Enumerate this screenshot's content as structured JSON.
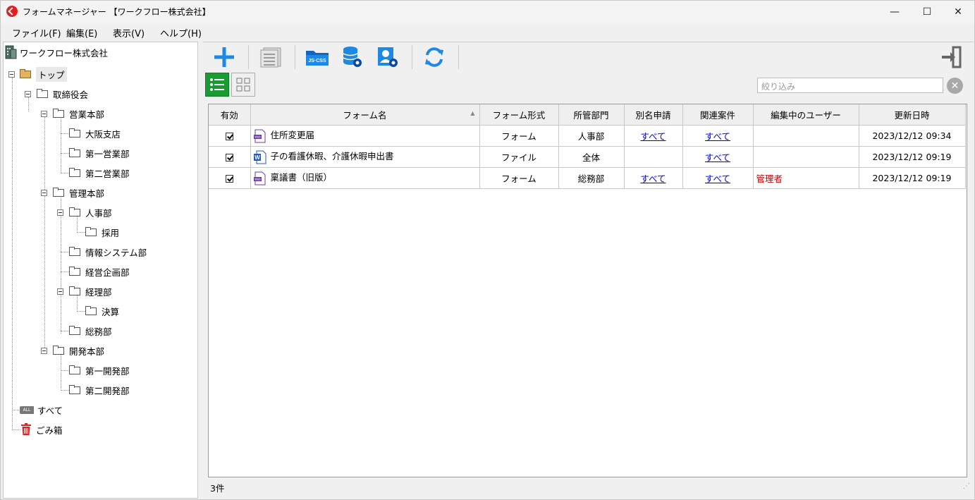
{
  "window": {
    "title": "フォームマネージャー 【ワークフロー株式会社】",
    "minimize": "—",
    "maximize": "☐",
    "close": "✕"
  },
  "menu": [
    "ファイル(F)",
    "編集(E)",
    "表示(V)",
    "ヘルプ(H)"
  ],
  "tree": {
    "root": "ワークフロー株式会社",
    "top": "トップ",
    "nodes": [
      "取締役会",
      "営業本部",
      "大阪支店",
      "第一営業部",
      "第二営業部",
      "管理本部",
      "人事部",
      "採用",
      "情報システム部",
      "経営企画部",
      "経理部",
      "決算",
      "総務部",
      "開発本部",
      "第一開発部",
      "第二開発部"
    ],
    "all": "すべて",
    "all_badge": "ALL",
    "trash": "ごみ箱"
  },
  "filter": {
    "placeholder": "絞り込み"
  },
  "table": {
    "columns": [
      "有効",
      "フォーム名",
      "フォーム形式",
      "所管部門",
      "別名申請",
      "関連案件",
      "編集中のユーザー",
      "更新日時"
    ],
    "rows": [
      {
        "enabled": true,
        "icon": "web-form-icon",
        "name": "住所変更届",
        "type": "フォーム",
        "dept": "人事部",
        "alias": "すべて",
        "related": "すべて",
        "editor": "",
        "updated": "2023/12/12 09:34"
      },
      {
        "enabled": true,
        "icon": "word-file-icon",
        "name": "子の看護休暇、介護休暇申出書",
        "type": "ファイル",
        "dept": "全体",
        "alias": "",
        "related": "すべて",
        "editor": "",
        "updated": "2023/12/12 09:19"
      },
      {
        "enabled": true,
        "icon": "web-form-icon",
        "name": "稟議書（旧版）",
        "type": "フォーム",
        "dept": "総務部",
        "alias": "すべて",
        "related": "すべて",
        "editor": "管理者",
        "updated": "2023/12/12 09:19"
      }
    ]
  },
  "status": {
    "count": "3件"
  },
  "colors": {
    "accent_blue": "#1e88e5",
    "view_green": "#1a9a32",
    "link": "#0000ee",
    "editor_red": "#d00000"
  }
}
